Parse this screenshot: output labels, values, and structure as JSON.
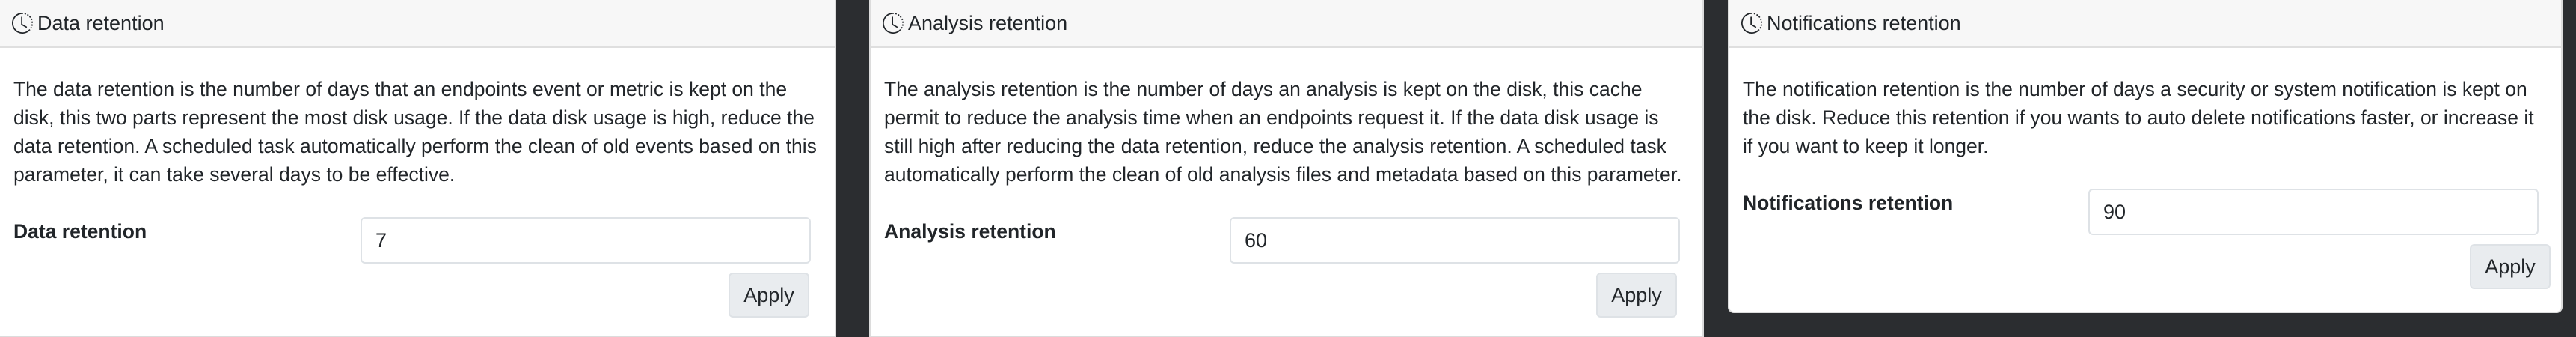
{
  "panels": [
    {
      "title": "Data retention",
      "icon": "history-icon",
      "description": "The data retention is the number of days that an endpoints event or metric is kept on the disk, this two parts represent the most disk usage. If the data disk usage is high, reduce the data retention. A scheduled task automatically perform the clean of old events based on this parameter, it can take several days to be effective.",
      "field_label": "Data retention",
      "field_value": "7",
      "apply_label": "Apply"
    },
    {
      "title": "Analysis retention",
      "icon": "history-icon",
      "description": "The analysis retention is the number of days an analysis is kept on the disk, this cache permit to reduce the analysis time when an endpoints request it. If the data disk usage is still high after reducing the data retention, reduce the analysis retention. A scheduled task automatically perform the clean of old analysis files and metadata based on this parameter.",
      "field_label": "Analysis retention",
      "field_value": "60",
      "apply_label": "Apply"
    },
    {
      "title": "Notifications retention",
      "icon": "history-icon",
      "description": "The notification retention is the number of days a security or system notification is kept on the disk. Reduce this retention if you wants to auto delete notifications faster, or increase it if you want to keep it longer.",
      "field_label": "Notifications retention",
      "field_value": "90",
      "apply_label": "Apply"
    }
  ]
}
